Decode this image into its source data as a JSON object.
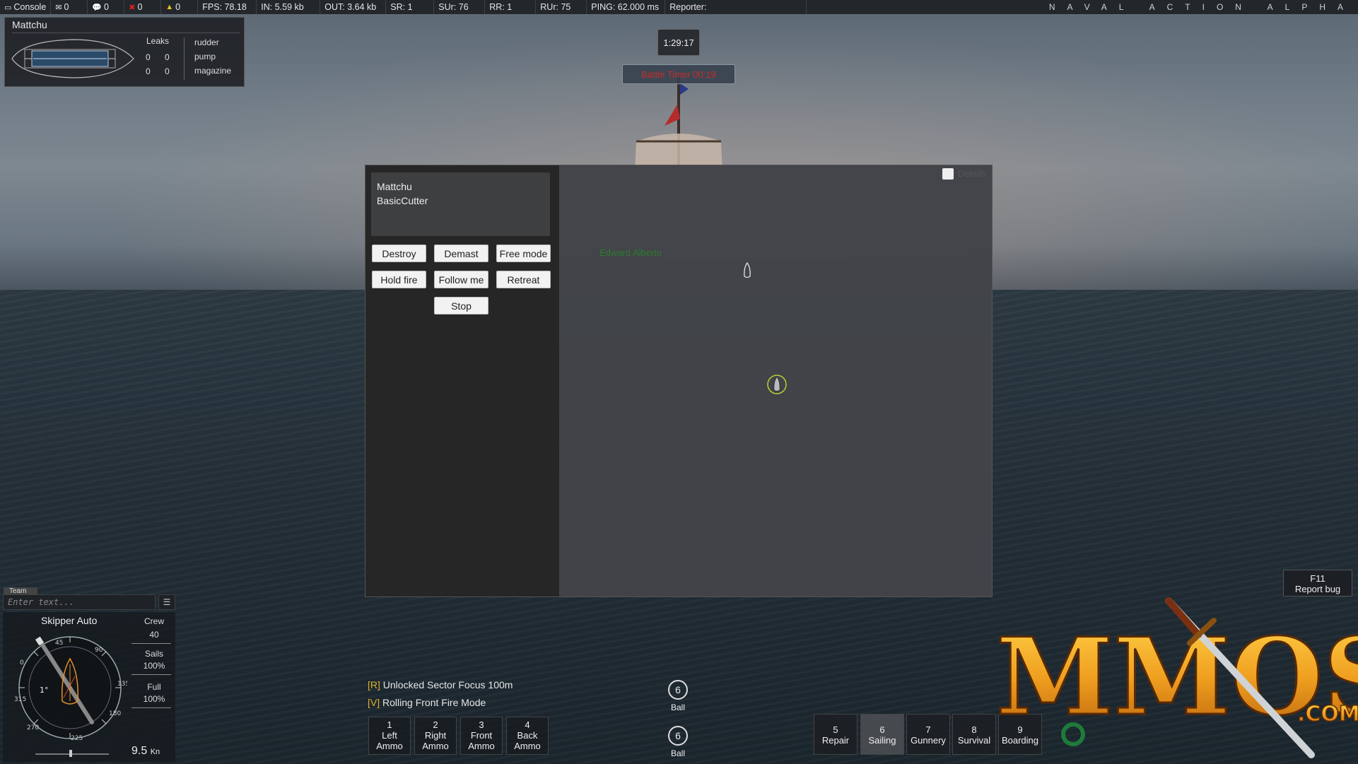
{
  "topbar": {
    "console": "Console",
    "messages": "0",
    "chat": "0",
    "errors": "0",
    "warnings": "0",
    "fps": "FPS: 78.18",
    "in": "IN: 5.59 kb",
    "out": "OUT: 3.64 kb",
    "sr": "SR: 1",
    "sur": "SUr: 76",
    "rr": "RR: 1",
    "rur": "RUr: 75",
    "ping": "PING: 62.000 ms",
    "reporter": "Reporter:",
    "game_title": "NAVAL ACTION ALPHA"
  },
  "status_panel": {
    "player_name": "Mattchu",
    "leaks_label": "Leaks",
    "leaks": [
      "0",
      "0",
      "0",
      "0"
    ],
    "systems": [
      "rudder",
      "pump",
      "magazine"
    ]
  },
  "timer": "1:29:17",
  "battle_timer": "Battle Timer 00:19",
  "modal": {
    "info_name": "Mattchu",
    "info_ship": "BasicCutter",
    "buttons": {
      "destroy": "Destroy",
      "demast": "Demast",
      "free_mode": "Free mode",
      "hold_fire": "Hold fire",
      "follow_me": "Follow me",
      "retreat": "Retreat",
      "stop": "Stop"
    },
    "details_label": "Details",
    "enemy_name": "Edward Alberto"
  },
  "chat": {
    "tab": "Team",
    "placeholder": "Enter text...",
    "menu_icon": "list-icon"
  },
  "ship_status": {
    "skipper": "Skipper Auto",
    "crew_label": "Crew",
    "crew_value": "40",
    "sails_label": "Sails",
    "sails_value": "100%",
    "full_label": "Full",
    "full_value": "100%",
    "heel": "1°",
    "speed_value": "9.5",
    "speed_unit": "Kn",
    "compass_ticks": [
      "45",
      "90",
      "135",
      "180",
      "225",
      "270",
      "315",
      "0"
    ]
  },
  "notifications": [
    {
      "key": "[R]",
      "text": "Unlocked Sector Focus 100m"
    },
    {
      "key": "[V]",
      "text": "Rolling Front Fire Mode"
    }
  ],
  "ammo_slots": [
    {
      "num": "1",
      "line1": "Left",
      "line2": "Ammo"
    },
    {
      "num": "2",
      "line1": "Right",
      "line2": "Ammo"
    },
    {
      "num": "3",
      "line1": "Front",
      "line2": "Ammo"
    },
    {
      "num": "4",
      "line1": "Back",
      "line2": "Ammo"
    }
  ],
  "ball_indicators": [
    {
      "count": "6",
      "label": "Ball"
    },
    {
      "count": "6",
      "label": "Ball"
    }
  ],
  "skill_slots": [
    {
      "num": "5",
      "label": "Repair"
    },
    {
      "num": "6",
      "label": "Sailing"
    },
    {
      "num": "7",
      "label": "Gunnery"
    },
    {
      "num": "8",
      "label": "Survival"
    },
    {
      "num": "9",
      "label": "Boarding"
    }
  ],
  "report_bug": {
    "key": "F11",
    "label": "Report bug"
  },
  "watermark": {
    "text": "MMOS",
    "suffix": ".COM"
  },
  "colors": {
    "battle_timer_text": "#c62b2b",
    "enemy_name": "#2d7a2d",
    "notification_key": "#d8b030",
    "logo_gold": "#e8a020"
  }
}
